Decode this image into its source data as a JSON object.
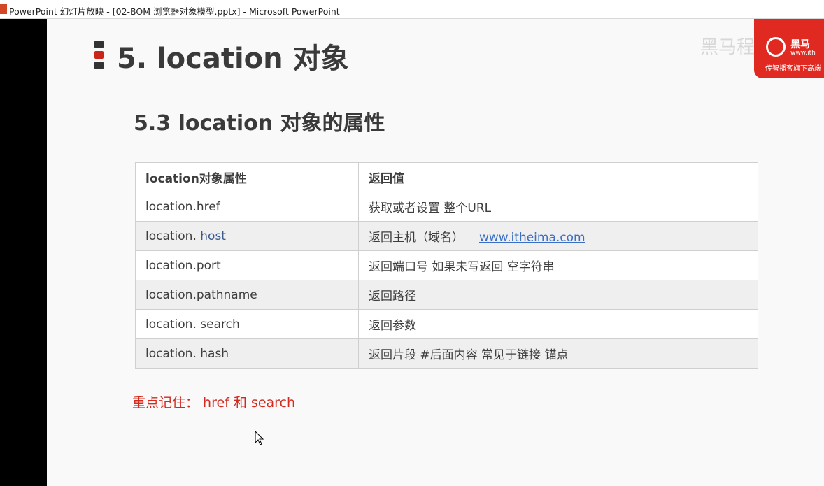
{
  "window": {
    "title": "PowerPoint 幻灯片放映 - [02-BOM 浏览器对象模型.pptx] - Microsoft PowerPoint"
  },
  "slide": {
    "title": "5. location 对象",
    "subtitle": "5.3 location 对象的属性",
    "logo": {
      "brand": "黑马",
      "url": "www.ith",
      "slogan": "传智播客旗下高端",
      "watermark": "黑马程序员"
    },
    "table": {
      "headers": [
        "location对象属性",
        "返回值"
      ],
      "rows": [
        {
          "prop": " location.href",
          "value": "获取或者设置 整个URL"
        },
        {
          "prop_prefix": "location. ",
          "prop_host": "host",
          "value": "返回主机（域名）",
          "link": "www.itheima.com"
        },
        {
          "prop": "location.port",
          "value": "返回端口号  如果未写返回 空字符串"
        },
        {
          "prop": "location.pathname",
          "value": "返回路径"
        },
        {
          "prop": "location. search",
          "value": "返回参数"
        },
        {
          "prop": "location. hash",
          "value": "返回片段   #后面内容 常见于链接 锚点"
        }
      ]
    },
    "note": "重点记住： href 和 search"
  },
  "colors": {
    "accent_red": "#d32a1f",
    "logo_red": "#e02a21",
    "link_blue": "#3a6fc4"
  }
}
